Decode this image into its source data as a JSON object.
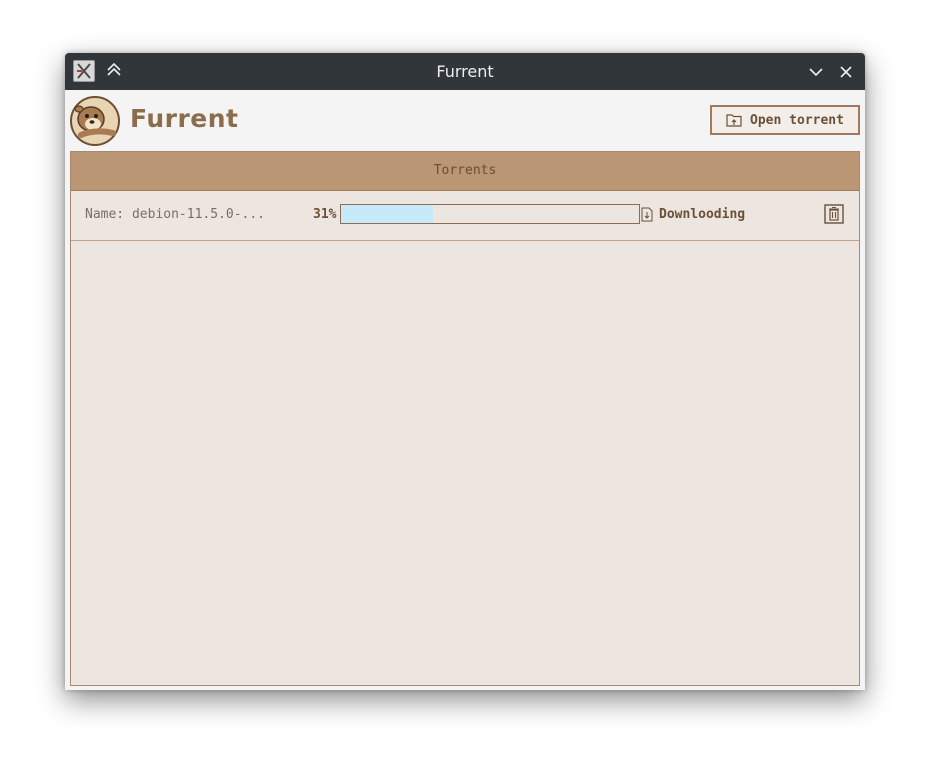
{
  "window": {
    "title": "Furrent"
  },
  "header": {
    "app_name": "Furrent",
    "open_button_label": "Open torrent"
  },
  "list": {
    "header_title": "Torrents",
    "torrents": [
      {
        "name": "Name: debion-11.5.0-...",
        "percent_label": "31%",
        "progress": 0.31,
        "status": "Downlooding"
      }
    ]
  },
  "colors": {
    "titlebar": "#31363b",
    "accent_brown": "#bb9674",
    "text_brown": "#6a5038",
    "progress_fill": "#c6eafa",
    "list_background": "#ede6e0"
  },
  "icons": {
    "app_icon": "app-icon",
    "keep_above": "chevrons-up-icon",
    "minimize": "chevron-down-icon",
    "close": "close-icon",
    "logo": "otter-logo-icon",
    "open": "folder-open-icon",
    "status": "download-file-icon",
    "delete": "trash-icon"
  }
}
